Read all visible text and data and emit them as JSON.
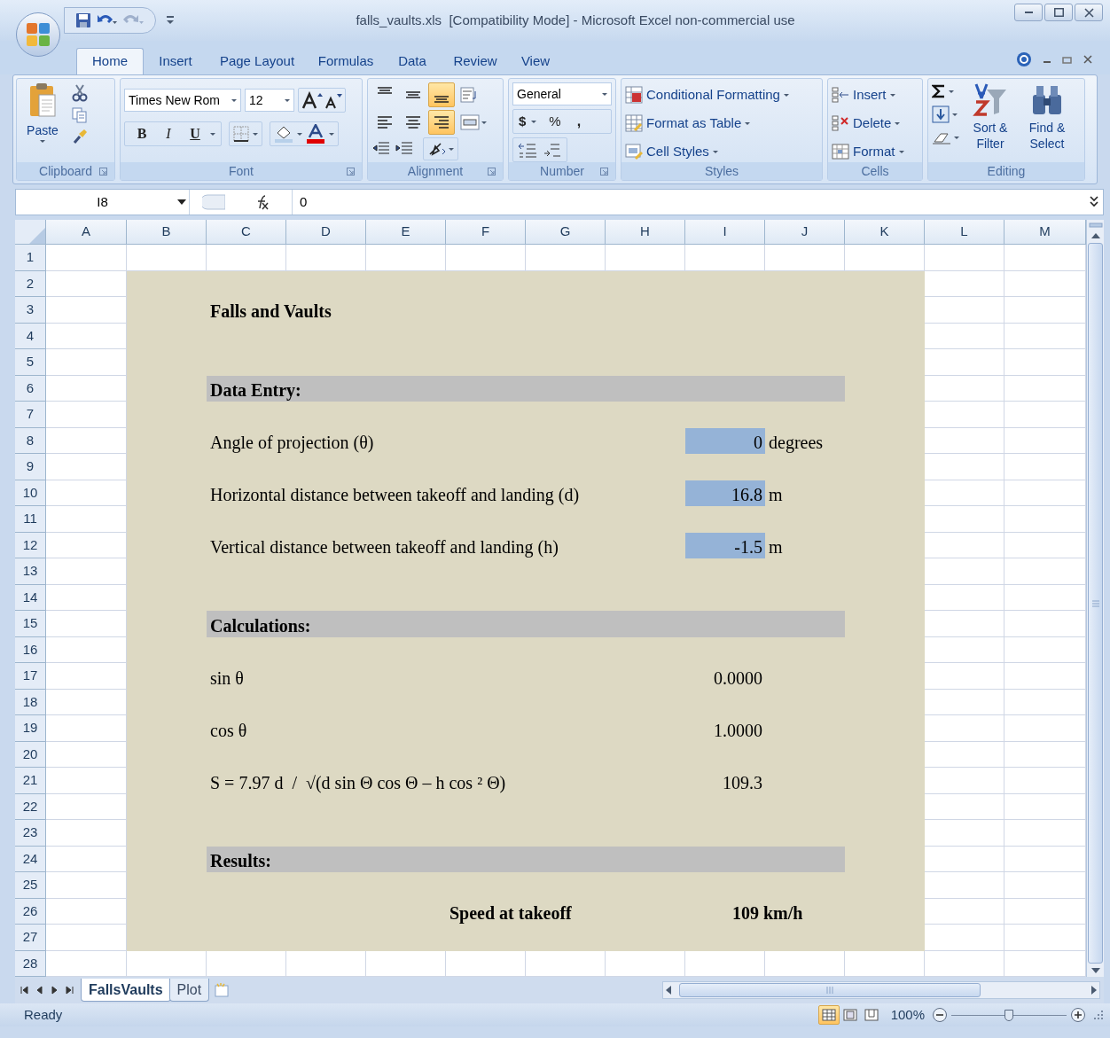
{
  "window": {
    "title": "falls_vaults.xls  [Compatibility Mode] - Microsoft Excel non-commercial use"
  },
  "ribbon_tabs": [
    {
      "label": "Home",
      "selected": true
    },
    {
      "label": "Insert",
      "selected": false
    },
    {
      "label": "Page Layout",
      "selected": false
    },
    {
      "label": "Formulas",
      "selected": false
    },
    {
      "label": "Data",
      "selected": false
    },
    {
      "label": "Review",
      "selected": false
    },
    {
      "label": "View",
      "selected": false
    }
  ],
  "clipboard": {
    "paste": "Paste",
    "label": "Clipboard"
  },
  "font": {
    "name": "Times New Rom",
    "size": "12",
    "bold": "B",
    "italic": "I",
    "underline": "U",
    "label": "Font"
  },
  "alignment": {
    "label": "Alignment",
    "buttons": [
      {
        "kind": "top",
        "selected": false
      },
      {
        "kind": "middle",
        "selected": false
      },
      {
        "kind": "bottom",
        "selected": true
      },
      {
        "kind": "left",
        "selected": false
      },
      {
        "kind": "center",
        "selected": false
      },
      {
        "kind": "right",
        "selected": true
      }
    ]
  },
  "number": {
    "format": "General",
    "currency": "$",
    "percent": "%",
    "comma": ",",
    "label": "Number"
  },
  "styles": {
    "items": [
      "Conditional Formatting",
      "Format as Table",
      "Cell Styles"
    ],
    "label": "Styles"
  },
  "cells": {
    "items": [
      "Insert",
      "Delete",
      "Format"
    ],
    "label": "Cells"
  },
  "editing": {
    "sort": "Sort & Filter",
    "find": "Find & Select",
    "label": "Editing"
  },
  "formula_bar": {
    "name_box": "I8",
    "value": "0"
  },
  "sheet": {
    "columns": [
      "A",
      "B",
      "C",
      "D",
      "E",
      "F",
      "G",
      "H",
      "I",
      "J",
      "K",
      "L",
      "M"
    ],
    "rows": [
      {
        "number": "1"
      },
      {
        "number": "2"
      },
      {
        "number": "3",
        "cells": [
          {
            "kind": "title",
            "text": "Falls and Vaults"
          }
        ]
      },
      {
        "number": "4"
      },
      {
        "number": "5"
      },
      {
        "number": "6",
        "cells": [
          {
            "kind": "section",
            "text": "Data Entry:"
          }
        ]
      },
      {
        "number": "7"
      },
      {
        "number": "8",
        "cells": [
          {
            "kind": "label",
            "text": "Angle of projection (θ)"
          },
          {
            "kind": "input",
            "text": "0"
          },
          {
            "kind": "unit",
            "text": "degrees"
          }
        ]
      },
      {
        "number": "9"
      },
      {
        "number": "10",
        "cells": [
          {
            "kind": "label",
            "text": "Horizontal distance between takeoff and landing (d)"
          },
          {
            "kind": "input",
            "text": "16.8"
          },
          {
            "kind": "unit",
            "text": "m"
          }
        ]
      },
      {
        "number": "11"
      },
      {
        "number": "12",
        "cells": [
          {
            "kind": "label",
            "text": "Vertical distance between takeoff and landing (h)"
          },
          {
            "kind": "input",
            "text": "-1.5"
          },
          {
            "kind": "unit",
            "text": "m"
          }
        ]
      },
      {
        "number": "13"
      },
      {
        "number": "14"
      },
      {
        "number": "15",
        "cells": [
          {
            "kind": "section",
            "text": "Calculations:"
          }
        ]
      },
      {
        "number": "16"
      },
      {
        "number": "17",
        "cells": [
          {
            "kind": "label",
            "text": "sin θ"
          },
          {
            "kind": "value",
            "text": "0.0000"
          }
        ]
      },
      {
        "number": "18"
      },
      {
        "number": "19",
        "cells": [
          {
            "kind": "label",
            "text": "cos θ"
          },
          {
            "kind": "value",
            "text": "1.0000"
          }
        ]
      },
      {
        "number": "20"
      },
      {
        "number": "21",
        "cells": [
          {
            "kind": "label",
            "text": "S = 7.97 d  /  √(d sin Θ cos Θ – h cos ² Θ)"
          },
          {
            "kind": "value",
            "text": "109.3"
          }
        ]
      },
      {
        "number": "22"
      },
      {
        "number": "23"
      },
      {
        "number": "24",
        "cells": [
          {
            "kind": "section",
            "text": "Results:"
          }
        ]
      },
      {
        "number": "25"
      },
      {
        "number": "26",
        "cells": [
          {
            "kind": "result",
            "text": "Speed at takeoff"
          },
          {
            "kind": "result-value",
            "text": "109 km/h"
          }
        ]
      },
      {
        "number": "27"
      },
      {
        "number": "28"
      }
    ]
  },
  "sheet_tabs": [
    {
      "label": "FallsVaults",
      "selected": true
    },
    {
      "label": "Plot",
      "selected": false
    }
  ],
  "status_bar": {
    "text": "Ready",
    "views": [
      {
        "kind": "normal",
        "selected": true
      },
      {
        "kind": "layout",
        "selected": false
      },
      {
        "kind": "break",
        "selected": false
      }
    ],
    "zoom": "100%",
    "zoom_slider": {
      "level": 0.5
    }
  }
}
